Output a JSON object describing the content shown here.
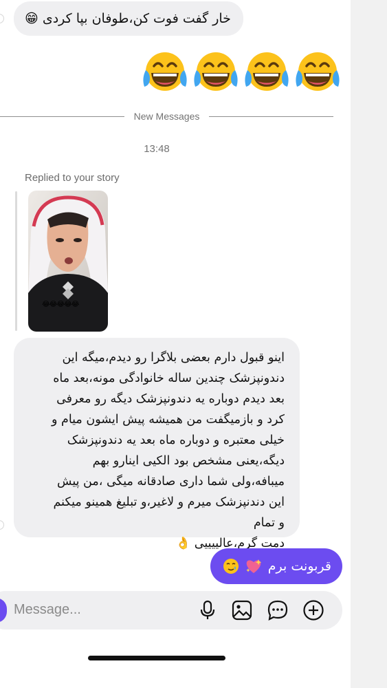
{
  "colors": {
    "accent": "#6c4cf0",
    "incoming_bubble": "#efeff1",
    "meta_text": "#737373"
  },
  "messages": {
    "first_incoming": "خار گفت فوت کن،طوفان بپا کردی 😁",
    "reaction_emojis": [
      "laughing-tears-emoji",
      "laughing-tears-emoji",
      "laughing-tears-emoji",
      "laughing-tears-emoji"
    ],
    "divider_label": "New Messages",
    "timestamp": "13:48",
    "replied_label": "Replied to your story",
    "story_caption": "😂😂😂😂😂",
    "long_message_lines": [
      "اینو قبول دارم بعضی بلاگرا رو دیدم،میگه این",
      "دندونپزشک چندین ساله خانوادگی مونه،بعد ماه",
      "بعد دیدم دوباره یه دندونپزشک دیگه رو معرفی",
      "کرد و بازمیگفت من همیشه پیش ایشون میام و",
      "خیلی معتبره و دوباره ماه بعد یه دندونپزشک",
      "دیگه،یعنی مشخص بود الکیی اینارو بهم",
      "میبافه،ولی شما داری صادقانه  میگی ،من پیش",
      "این دندنپزشک میرم و لاغیر،و تبلیغ همینو میکنم",
      "و تمام",
      "دمت گرم،عالییییی 👌"
    ],
    "outgoing": "قربونت برم",
    "outgoing_emojis": [
      "sparkling-heart-emoji",
      "tearful-smile-emoji"
    ]
  },
  "composer": {
    "placeholder": "Message...",
    "icons": [
      "camera-icon",
      "microphone-icon",
      "gallery-icon",
      "sticker-chat-icon",
      "add-icon"
    ]
  }
}
